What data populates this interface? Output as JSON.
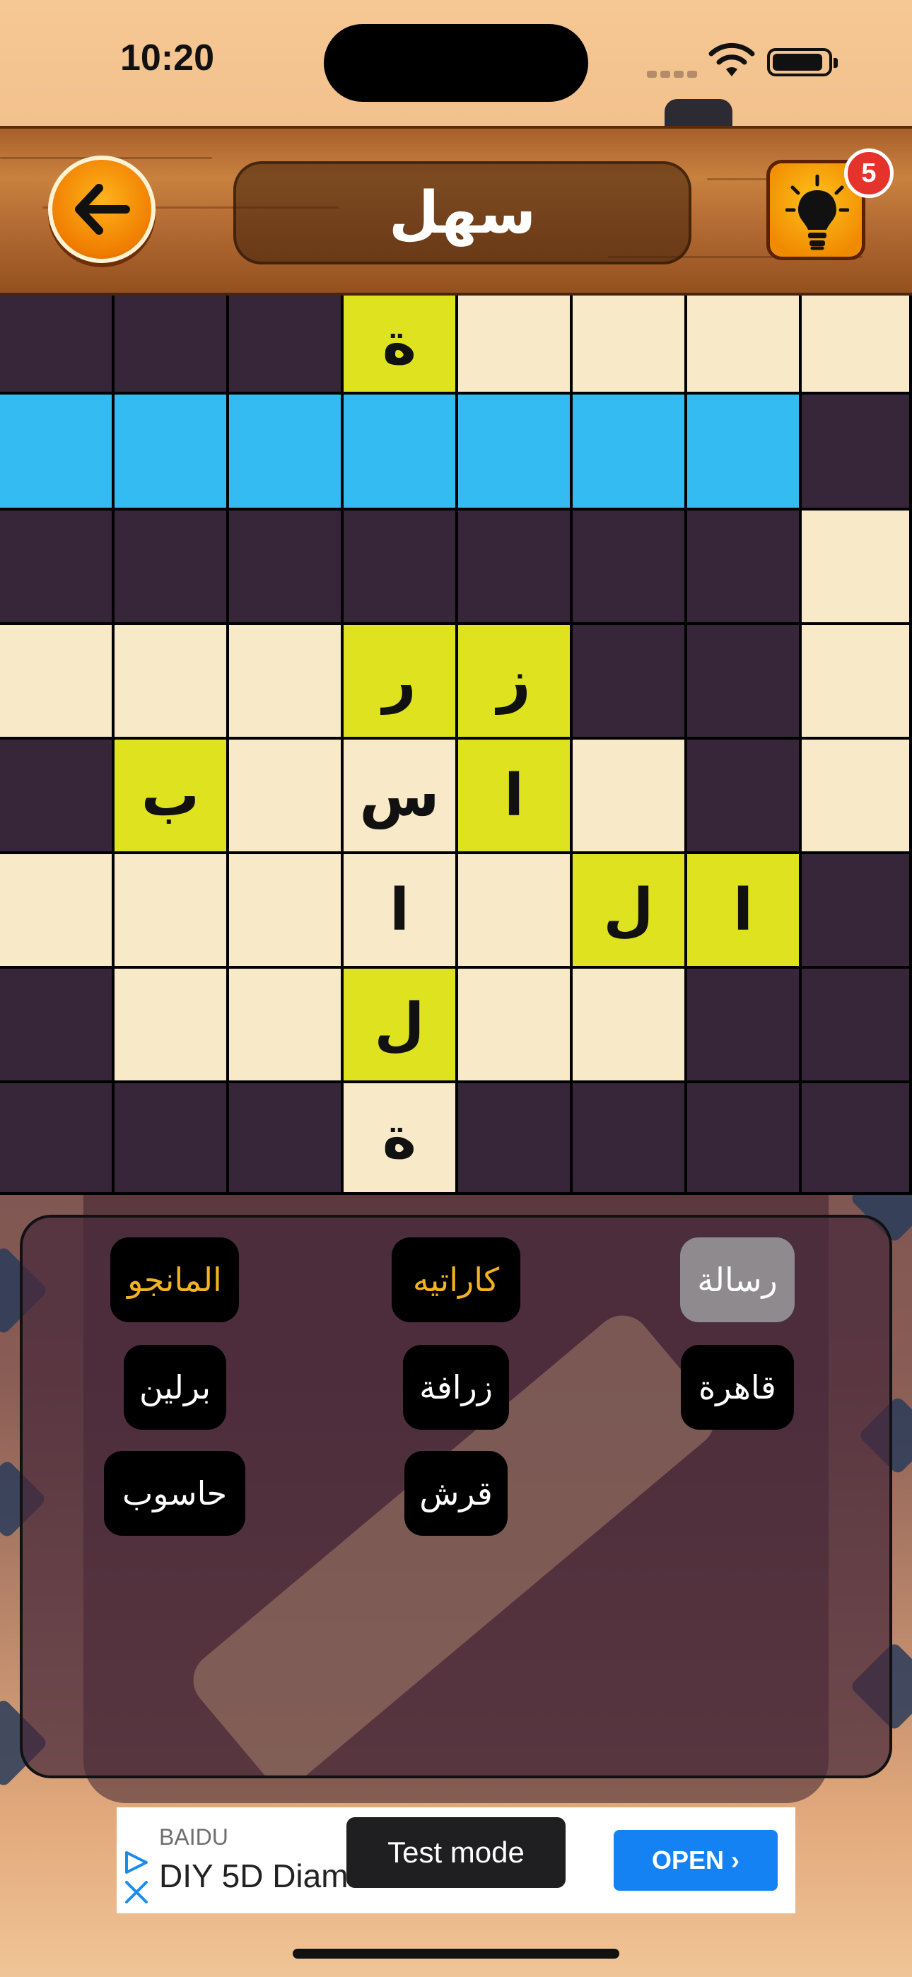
{
  "status_bar": {
    "time": "10:20"
  },
  "header": {
    "title": "سهل",
    "hint_count": "5",
    "back_icon": "arrow-left-icon",
    "hint_icon": "lightbulb-icon"
  },
  "grid": {
    "rows": [
      [
        {
          "t": "dark",
          "l": ""
        },
        {
          "t": "dark",
          "l": ""
        },
        {
          "t": "dark",
          "l": ""
        },
        {
          "t": "yellow",
          "l": "ة"
        },
        {
          "t": "cream",
          "l": ""
        },
        {
          "t": "cream",
          "l": ""
        },
        {
          "t": "cream",
          "l": ""
        },
        {
          "t": "cream",
          "l": ""
        }
      ],
      [
        {
          "t": "blue",
          "l": ""
        },
        {
          "t": "blue",
          "l": ""
        },
        {
          "t": "blue",
          "l": ""
        },
        {
          "t": "blue",
          "l": ""
        },
        {
          "t": "blue",
          "l": ""
        },
        {
          "t": "blue",
          "l": ""
        },
        {
          "t": "blue",
          "l": ""
        },
        {
          "t": "dark",
          "l": ""
        }
      ],
      [
        {
          "t": "dark",
          "l": ""
        },
        {
          "t": "dark",
          "l": ""
        },
        {
          "t": "dark",
          "l": ""
        },
        {
          "t": "dark",
          "l": ""
        },
        {
          "t": "dark",
          "l": ""
        },
        {
          "t": "dark",
          "l": ""
        },
        {
          "t": "dark",
          "l": ""
        },
        {
          "t": "cream",
          "l": ""
        }
      ],
      [
        {
          "t": "cream",
          "l": ""
        },
        {
          "t": "cream",
          "l": ""
        },
        {
          "t": "cream",
          "l": ""
        },
        {
          "t": "yellow",
          "l": "ر"
        },
        {
          "t": "yellow",
          "l": "ز"
        },
        {
          "t": "dark",
          "l": ""
        },
        {
          "t": "dark",
          "l": ""
        },
        {
          "t": "cream",
          "l": ""
        }
      ],
      [
        {
          "t": "dark",
          "l": ""
        },
        {
          "t": "yellow",
          "l": "ب"
        },
        {
          "t": "cream",
          "l": ""
        },
        {
          "t": "cream",
          "l": "س"
        },
        {
          "t": "yellow",
          "l": "ا"
        },
        {
          "t": "cream",
          "l": ""
        },
        {
          "t": "dark",
          "l": ""
        },
        {
          "t": "cream",
          "l": ""
        }
      ],
      [
        {
          "t": "cream",
          "l": ""
        },
        {
          "t": "cream",
          "l": ""
        },
        {
          "t": "cream",
          "l": ""
        },
        {
          "t": "cream",
          "l": "ا"
        },
        {
          "t": "cream",
          "l": ""
        },
        {
          "t": "yellow",
          "l": "ل"
        },
        {
          "t": "yellow",
          "l": "ا"
        },
        {
          "t": "dark",
          "l": ""
        }
      ],
      [
        {
          "t": "dark",
          "l": ""
        },
        {
          "t": "cream",
          "l": ""
        },
        {
          "t": "cream",
          "l": ""
        },
        {
          "t": "yellow",
          "l": "ل"
        },
        {
          "t": "cream",
          "l": ""
        },
        {
          "t": "cream",
          "l": ""
        },
        {
          "t": "dark",
          "l": ""
        },
        {
          "t": "dark",
          "l": ""
        }
      ],
      [
        {
          "t": "dark",
          "l": ""
        },
        {
          "t": "dark",
          "l": ""
        },
        {
          "t": "dark",
          "l": ""
        },
        {
          "t": "cream",
          "l": "ة"
        },
        {
          "t": "dark",
          "l": ""
        },
        {
          "t": "dark",
          "l": ""
        },
        {
          "t": "dark",
          "l": ""
        },
        {
          "t": "dark",
          "l": ""
        }
      ]
    ]
  },
  "words": [
    {
      "label": "رسالة",
      "state": "used"
    },
    {
      "label": "كاراتيه",
      "state": "found"
    },
    {
      "label": "المانجو",
      "state": "found"
    },
    {
      "label": "قاهرة",
      "state": "open"
    },
    {
      "label": "زرافة",
      "state": "open"
    },
    {
      "label": "برلين",
      "state": "open"
    },
    {
      "label": "قرش",
      "state": "open"
    },
    {
      "label": "حاسوب",
      "state": "open"
    }
  ],
  "ad": {
    "brand": "BAIDU",
    "title": "DIY 5D Diamond",
    "test_mode": "Test mode",
    "open_label": "OPEN ›"
  },
  "colors": {
    "dark_cell": "#37253a",
    "cream_cell": "#f8e9c8",
    "yellow_cell": "#dfe31f",
    "blue_cell": "#33bbf2",
    "found_word": "#f2b320"
  }
}
